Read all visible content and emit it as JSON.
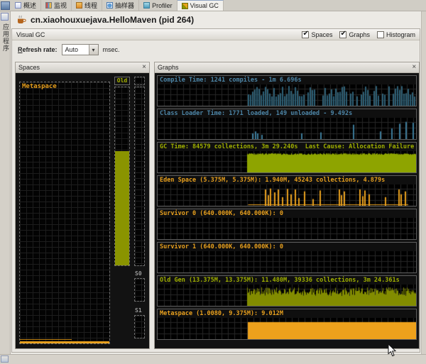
{
  "ui": {
    "close": "×",
    "dropdown_arrow": "▾",
    "check": "✔"
  },
  "window": {
    "sidebar_label": "应用程序",
    "tabs": [
      {
        "label": "概述",
        "icon": "overview-icon",
        "selected": false
      },
      {
        "label": "监视",
        "icon": "monitor-icon",
        "selected": false
      },
      {
        "label": "线程",
        "icon": "threads-icon",
        "selected": false
      },
      {
        "label": "抽样器",
        "icon": "sampler-icon",
        "selected": false
      },
      {
        "label": "Profiler",
        "icon": "profiler-icon",
        "selected": false
      },
      {
        "label": "Visual GC",
        "icon": "visualgc-icon",
        "selected": true
      }
    ]
  },
  "header": {
    "title": "cn.xiaohouxuejava.HelloMaven (pid 264)"
  },
  "toolbar": {
    "title": "Visual GC",
    "checkboxes": [
      {
        "label": "Spaces",
        "checked": true
      },
      {
        "label": "Graphs",
        "checked": true
      },
      {
        "label": "Histogram",
        "checked": false
      }
    ]
  },
  "refresh": {
    "label": "Refresh rate:",
    "value": "Auto",
    "unit": "msec."
  },
  "spaces": {
    "title": "Spaces",
    "metaspace_label": "Metaspace",
    "old_label": "Old",
    "s0_label": "S0",
    "s1_label": "S1",
    "old_fill_pct": 64,
    "metaspace_fill_pct": 2
  },
  "graphs": {
    "title": "Graphs"
  },
  "chart_data": [
    {
      "type": "bar",
      "title": "Compile Time: 1241 compiles - 1m 6.696s",
      "title_color": "#4d86a8",
      "color": "#2d6076",
      "style": "bars",
      "start": 0.35,
      "seed": 7
    },
    {
      "type": "bar",
      "title": "Class Loader Time: 1771 loaded, 149 unloaded - 9.492s",
      "title_color": "#4d86a8",
      "color": "#3c7a99",
      "style": "sparse",
      "spikes": [
        [
          0.365,
          0.3
        ],
        [
          0.375,
          0.4
        ],
        [
          0.385,
          0.3
        ],
        [
          0.4,
          0.22
        ],
        [
          0.555,
          0.3
        ],
        [
          0.63,
          0.35
        ],
        [
          0.755,
          0.75
        ],
        [
          0.86,
          0.4
        ],
        [
          0.905,
          0.55
        ],
        [
          0.935,
          0.8
        ],
        [
          0.96,
          0.9
        ],
        [
          0.985,
          0.85
        ]
      ]
    },
    {
      "type": "area",
      "title": "GC Time: 84579 collections, 3m 29.240s  Last Cause: Allocation Failure",
      "title_color": "#a0b000",
      "color": "#8ea400",
      "style": "solid",
      "start": 0.345,
      "level": 0.93,
      "seed": 3
    },
    {
      "type": "bar",
      "title": "Eden Space (5.375M, 5.375M): 1.940M, 45243 collections, 4.879s",
      "title_color": "#e8a01e",
      "color": "#e8a01e",
      "style": "spikes",
      "baseline": [
        0.35,
        0.97
      ],
      "spikes": [
        [
          0.415,
          0.85
        ],
        [
          0.425,
          0.55
        ],
        [
          0.435,
          0.9
        ],
        [
          0.45,
          0.7
        ],
        [
          0.465,
          0.85
        ],
        [
          0.48,
          0.45
        ],
        [
          0.5,
          0.88
        ],
        [
          0.515,
          0.6
        ],
        [
          0.53,
          0.85
        ],
        [
          0.545,
          0.4
        ],
        [
          0.565,
          0.75
        ],
        [
          0.6,
          0.35
        ],
        [
          0.625,
          0.8
        ],
        [
          0.7,
          0.85
        ],
        [
          0.71,
          0.55
        ],
        [
          0.72,
          0.75
        ],
        [
          0.78,
          0.85
        ],
        [
          0.79,
          0.5
        ],
        [
          0.8,
          0.8
        ],
        [
          0.815,
          0.6
        ],
        [
          0.88,
          0.45
        ],
        [
          0.93,
          0.85
        ],
        [
          0.94,
          0.6
        ],
        [
          0.955,
          0.75
        ]
      ]
    },
    {
      "type": "area",
      "title": "Survivor 0 (640.000K, 640.000K): 0",
      "title_color": "#e8a01e",
      "color": "#e8a01e",
      "style": "empty"
    },
    {
      "type": "area",
      "title": "Survivor 1 (640.000K, 640.000K): 0",
      "title_color": "#e8a01e",
      "color": "#e8a01e",
      "style": "empty"
    },
    {
      "type": "area",
      "title": "Old Gen (13.375M, 13.375M): 11.480M, 39336 collections, 3m 24.361s",
      "title_color": "#a0b000",
      "color": "#828c00",
      "style": "noisy",
      "start": 0.345,
      "level": 0.72,
      "noise": 0.22,
      "seed": 11
    },
    {
      "type": "area",
      "title": "Metaspace (1.0080, 9.375M): 9.012M",
      "title_color": "#e8a01e",
      "color": "#eda11c",
      "style": "block",
      "start": 0.35,
      "level": 0.86
    }
  ]
}
